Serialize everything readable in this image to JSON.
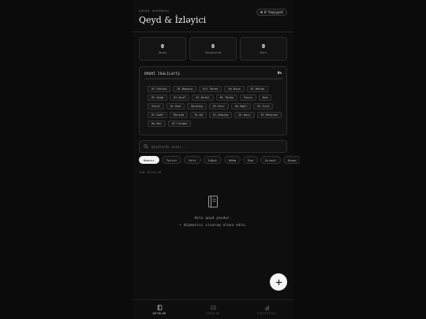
{
  "header": {
    "subtitle": "QURAN QORUNDAŞ",
    "title": "Qeyd & İzləyici",
    "status_badge": "O'faqiyyət"
  },
  "stats": [
    {
      "value": "0",
      "label": "Ümumi"
    },
    {
      "value": "0",
      "label": "Tamamlandı"
    },
    {
      "value": "0",
      "label": "Dərs"
    }
  ],
  "progress": {
    "title": "ÜMUMİ İRƏLİLƏYİŞ",
    "percent_text": "0%",
    "fraction": 0
  },
  "surahs": [
    "Əl-Fatihə",
    "Əl-Bəqərə",
    "Ali İmran",
    "Ən-Nisa",
    "Əl-Maidə",
    "Əl-Ənam",
    "Əl-Əraf",
    "Əl-Ənfal",
    "Ət-Tövbə",
    "Yunus",
    "Hud",
    "Yusuf",
    "Ər-Rəd",
    "İbrahim",
    "Əl-Hicr",
    "Ən-Nəhl",
    "Əl-İsra",
    "Əl-Kəhf",
    "Məryəm",
    "Ta-Ha",
    "Əl-Ənbiya",
    "Əl-Həcc",
    "Əl-Muminun",
    "Ən-Nur",
    "Əl-Furqan"
  ],
  "search": {
    "placeholder": "Qeydlərdə axtar..."
  },
  "filters": [
    "Hamısı",
    "Təfsir",
    "Hifz",
    "Lüğət",
    "Hökm",
    "Dua",
    "Qiraət",
    "Digər"
  ],
  "section_label": "SON QEYDLƏR",
  "empty_state": {
    "line1": "Hələ qeyd yoxdur.",
    "line2": "+ düyməsini sıxaraq əlavə edin."
  },
  "nav": [
    {
      "label": "QEYDLƏR",
      "icon": "book-icon"
    },
    {
      "label": "SURƏLƏR",
      "icon": "list-icon"
    },
    {
      "label": "STATİSTİKA",
      "icon": "bar-chart-icon"
    }
  ],
  "colors": {
    "background": "#0b0b0b",
    "accent": "#ffffff",
    "status": "#4caf50"
  }
}
